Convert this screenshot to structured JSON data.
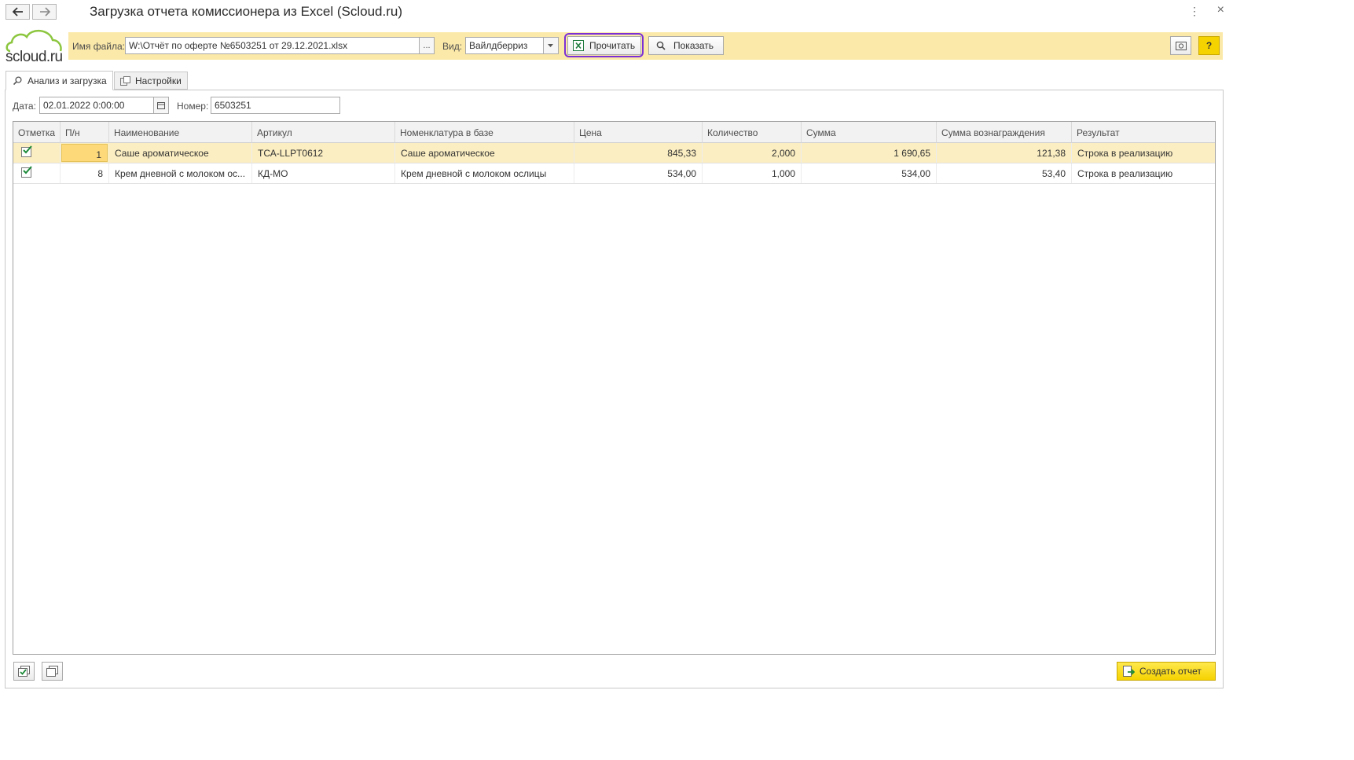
{
  "window": {
    "title": "Загрузка отчета комиссионера из Excel (Scloud.ru)",
    "more_glyph": "⋮",
    "close_glyph": "×"
  },
  "logo": {
    "text": "scloud.ru"
  },
  "toolbar": {
    "file_label": "Имя файла:",
    "file_value": "W:\\Отчёт по оферте №6503251 от 29.12.2021.xlsx",
    "file_select_glyph": "...",
    "kind_label": "Вид:",
    "kind_value": "Вайлдберриз",
    "read_label": "Прочитать",
    "show_label": "Показать",
    "help_glyph": "?"
  },
  "tabs": [
    {
      "label": "Анализ и загрузка"
    },
    {
      "label": "Настройки"
    }
  ],
  "form": {
    "date_label": "Дата:",
    "date_value": "02.01.2022  0:00:00",
    "number_label": "Номер:",
    "number_value": "6503251"
  },
  "table": {
    "headers": [
      "Отметка",
      "П/н",
      "Наименование",
      "Артикул",
      "Номенклатура в базе",
      "Цена",
      "Количество",
      "Сумма",
      "Сумма вознаграждения",
      "Результат"
    ],
    "rows": [
      {
        "checked": true,
        "pn": "1",
        "name": "Саше ароматическое",
        "article": "ТСА-LLPT0612",
        "nomenclature": "Саше ароматическое",
        "price": "845,33",
        "qty": "2,000",
        "sum": "1 690,65",
        "reward": "121,38",
        "result": "Строка в реализацию"
      },
      {
        "checked": true,
        "pn": "8",
        "name": "Крем дневной с молоком ос...",
        "article": "КД-МО",
        "nomenclature": "Крем дневной с молоком ослицы",
        "price": "534,00",
        "qty": "1,000",
        "sum": "534,00",
        "reward": "53,40",
        "result": "Строка в реализацию"
      }
    ]
  },
  "footer": {
    "create_label": "Создать отчет"
  },
  "colors": {
    "toolbar_bg": "#fbe9a9",
    "selected_row": "#fbeec2",
    "highlight": "#7b2fd6",
    "create_btn": "#f5d300",
    "logo_green": "#8cc63f"
  }
}
